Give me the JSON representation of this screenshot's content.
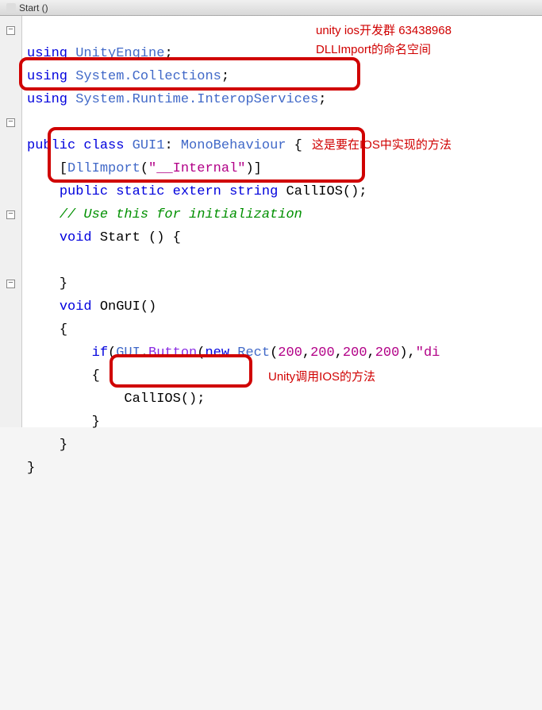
{
  "title": "Start ()",
  "code": {
    "l1_kw1": "using",
    "l1_type": "UnityEngine",
    "l1_semi": ";",
    "l2_kw1": "using",
    "l2_type": "System.Collections",
    "l2_semi": ";",
    "l3_kw1": "using",
    "l3_type": "System.Runtime.InteropServices",
    "l3_semi": ";",
    "l5_kw1": "public",
    "l5_kw2": "class",
    "l5_name": "GUI1",
    "l5_colon": ":",
    "l5_base": "MonoBehaviour",
    "l5_brace": " {",
    "l6_open": "[",
    "l6_attr": "DllImport",
    "l6_p1": "(",
    "l6_str": "\"__Internal\"",
    "l6_p2": ")",
    "l6_close": "]",
    "l7_kw1": "public",
    "l7_kw2": "static",
    "l7_kw3": "extern",
    "l7_kw4": "string",
    "l7_name": "CallIOS",
    "l7_p": "();",
    "l8_comment": "// Use this for initialization",
    "l9_kw": "void",
    "l9_name": "Start",
    "l9_p": " () {",
    "l11_brace": "}",
    "l12_kw": "void",
    "l12_name": "OnGUI",
    "l12_p": "()",
    "l13_brace": "{",
    "l14_kw": "if",
    "l14_p1": "(",
    "l14_gui": "GUI",
    "l14_dot": ".",
    "l14_btn": "Button",
    "l14_p2": "(",
    "l14_new": "new",
    "l14_rect": " Rect",
    "l14_p3": "(",
    "l14_n1": "200",
    "l14_c1": ",",
    "l14_n2": "200",
    "l14_c2": ",",
    "l14_n3": "200",
    "l14_c3": ",",
    "l14_n4": "200",
    "l14_p4": ")",
    "l14_c4": ",",
    "l14_str": "\"di",
    "l15_brace": "{",
    "l16_call": "CallIOS();",
    "l17_brace": "}",
    "l18_brace": "}",
    "l19_brace": "}"
  },
  "annotations": {
    "a1": "unity ios开发群 63438968",
    "a2": "DLLImport的命名空间",
    "a3": "这是要在IOS中实现的方法",
    "a4": "Unity调用IOS的方法"
  }
}
